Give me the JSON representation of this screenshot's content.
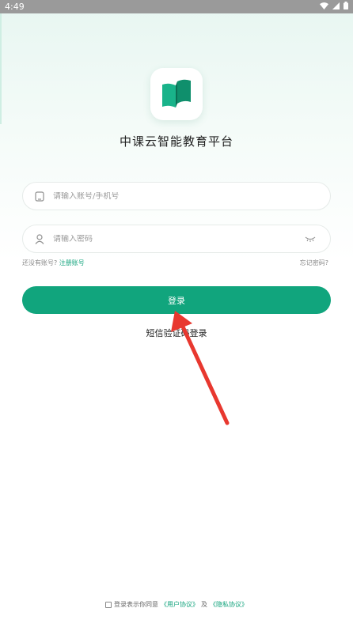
{
  "status_bar": {
    "time": "4:49",
    "icons": [
      "wifi-icon",
      "signal-icon",
      "battery-icon"
    ]
  },
  "app": {
    "title": "中课云智能教育平台",
    "logo_icon": "book-logo-icon",
    "brand_color": "#11a57d"
  },
  "form": {
    "account_placeholder": "请输入账号/手机号",
    "account_value": "",
    "password_placeholder": "请输入密码",
    "password_value": "",
    "no_account_text": "还没有账号?",
    "register_label": "注册账号",
    "forgot_label": "忘记密码?",
    "login_label": "登录",
    "sms_login_label": "短信验证码登录"
  },
  "agreement": {
    "prefix": "登录表示你同意",
    "user_agreement": "《用户协议》",
    "and": "及",
    "privacy_agreement": "《隐私协议》",
    "checked": false
  }
}
